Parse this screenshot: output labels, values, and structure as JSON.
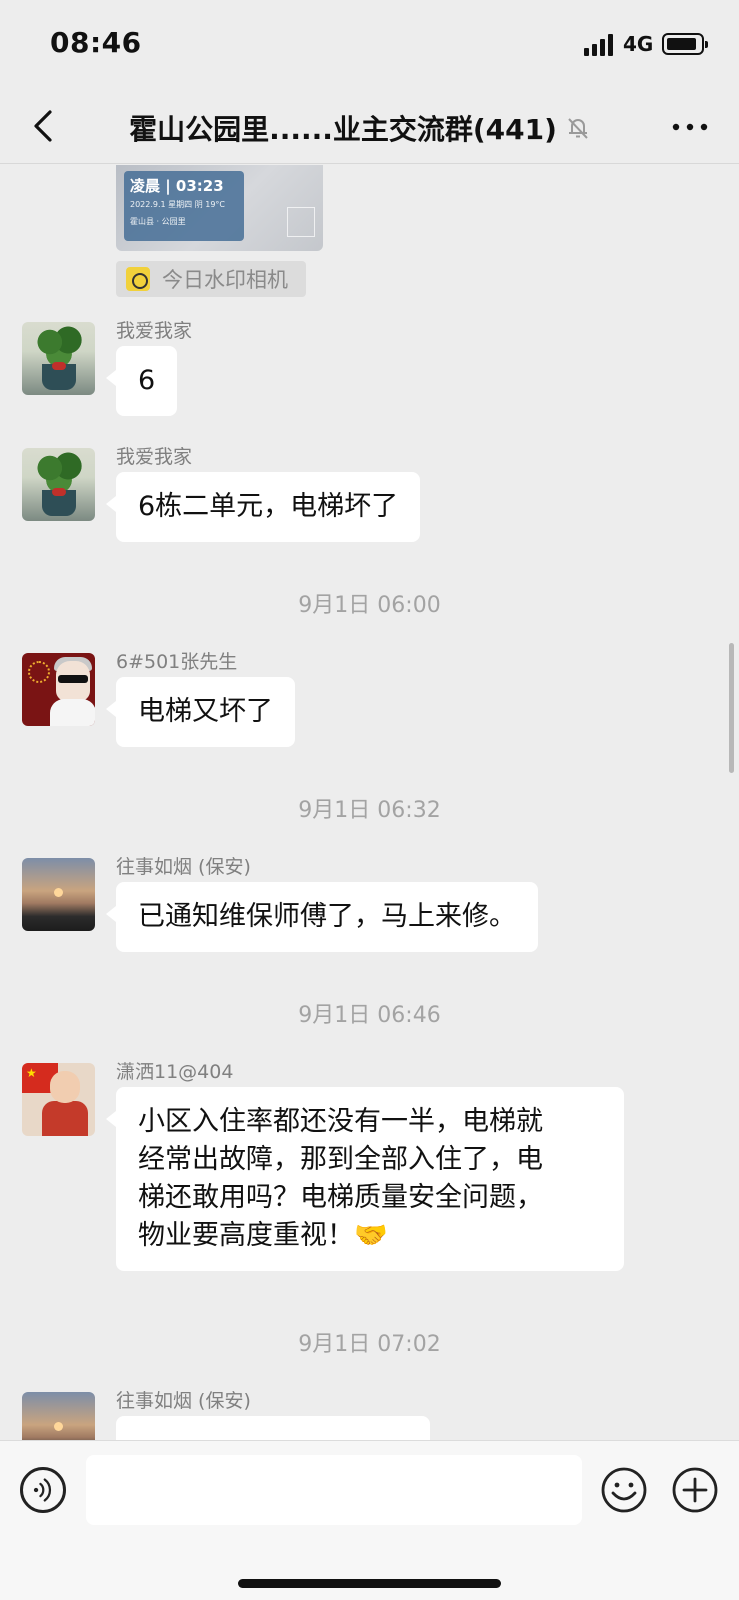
{
  "status_bar": {
    "time": "08:46",
    "network": "4G"
  },
  "nav": {
    "title": "霍山公园里......业主交流群(441)"
  },
  "chat": {
    "photo": {
      "watermark_time": "凌晨 | 03:23",
      "watermark_date": "2022.9.1 星期四 阴 19°C",
      "watermark_place": "霍山县 · 公园里",
      "source_name": "今日水印相机"
    },
    "messages": [
      {
        "sender": "我爱我家",
        "text": "6"
      },
      {
        "sender": "我爱我家",
        "text": "6栋二单元，电梯坏了"
      },
      {
        "time": "9月1日 06:00"
      },
      {
        "sender": "6#501张先生",
        "text": "电梯又坏了"
      },
      {
        "time": "9月1日 06:32"
      },
      {
        "sender": "往事如烟 (保安)",
        "text": "已通知维保师傅了，马上来修。"
      },
      {
        "time": "9月1日 06:46"
      },
      {
        "sender": "潇洒11@404",
        "lines": [
          "小区入住率都还没有一半，电梯就",
          "经常出故障，那到全部入住了，电",
          "梯还敢用吗？电梯质量安全问题，",
          "物业要高度重视！🤝"
        ]
      },
      {
        "time": "9月1日 07:02"
      },
      {
        "sender": "往事如烟 (保安)"
      }
    ]
  },
  "input_bar": {
    "placeholder": ""
  }
}
